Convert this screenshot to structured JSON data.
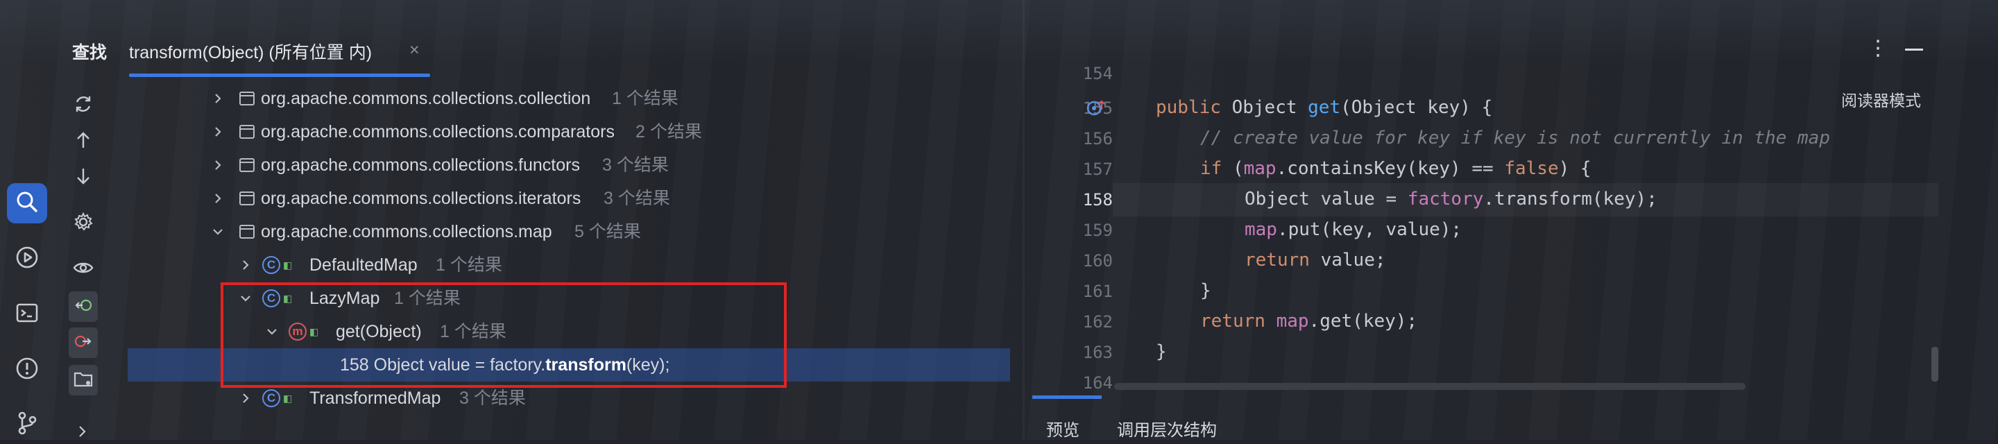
{
  "find_panel": {
    "title": "查找",
    "tab_label": "transform(Object) (所有位置 内)",
    "tab_close": "×"
  },
  "tree": {
    "rows": [
      {
        "label": "org.apache.commons.collections.collection",
        "count": "1 个结果"
      },
      {
        "label": "org.apache.commons.collections.comparators",
        "count": "2 个结果"
      },
      {
        "label": "org.apache.commons.collections.functors",
        "count": "3 个结果"
      },
      {
        "label": "org.apache.commons.collections.iterators",
        "count": "3 个结果"
      },
      {
        "label": "org.apache.commons.collections.map",
        "count": "5 个结果"
      },
      {
        "label": "DefaultedMap",
        "count": "1 个结果"
      },
      {
        "label": "LazyMap",
        "count": "1 个结果"
      },
      {
        "label": "get(Object)",
        "count": "1 个结果"
      },
      {
        "label_prefix": "158 Object value = factory.",
        "label_bold": "transform",
        "label_suffix": "(key);"
      },
      {
        "label": "TransformedMap",
        "count": "3 个结果"
      }
    ],
    "class_icon_letter": "C",
    "method_icon_letter": "m"
  },
  "editor": {
    "reader_mode": "阅读器模式",
    "menu_glyph": "⋮",
    "line_numbers": [
      "154",
      "155",
      "156",
      "157",
      "158",
      "159",
      "160",
      "161",
      "162",
      "163",
      "164"
    ],
    "code": {
      "l155": {
        "kw": "public",
        "type": " Object ",
        "fn": "get",
        "rest": "(Object key) {"
      },
      "l156": {
        "comment": "// create value for key if key is not currently in the map"
      },
      "l157": {
        "kw": "if",
        "a": " (",
        "fld": "map",
        "b": ".containsKey(key) == ",
        "kw2": "false",
        "c": ") {"
      },
      "l158": {
        "a": "Object value = ",
        "fld": "factory",
        "b": ".transform(key);"
      },
      "l159": {
        "fld": "map",
        "b": ".put(key, value);"
      },
      "l160": {
        "kw": "return",
        "b": " value;"
      },
      "l161": {
        "a": "}"
      },
      "l162": {
        "kw": "return",
        "sp": " ",
        "fld": "map",
        "b": ".get(key);"
      },
      "l163": {
        "a": "}"
      }
    }
  },
  "bottom_tabs": {
    "preview": "预览",
    "call_hierarchy": "调用层次结构"
  }
}
